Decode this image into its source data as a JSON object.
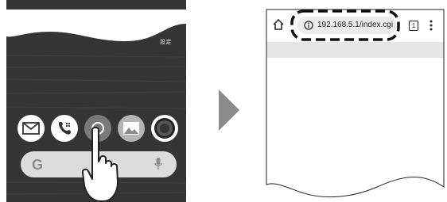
{
  "phone": {
    "settings_label": "設定",
    "dock_apps": [
      {
        "name": "mail",
        "icon": "envelope-icon"
      },
      {
        "name": "phone",
        "icon": "phone-icon"
      },
      {
        "name": "browser",
        "icon": "browser-circle-icon"
      },
      {
        "name": "gallery",
        "icon": "image-icon"
      },
      {
        "name": "camera",
        "icon": "camera-icon"
      }
    ],
    "search_bar": {
      "logo": "G",
      "mic_icon": "microphone-icon"
    },
    "gesture": "tap-hand-icon"
  },
  "arrow": {
    "icon": "right-arrow-icon"
  },
  "browser": {
    "home_icon": "home-icon",
    "info_icon": "info-icon",
    "url": "192.168.5.1/index.cgi",
    "tab_count": "1",
    "menu_icon": "more-vert-icon"
  },
  "colors": {
    "phone_bg": "#333333",
    "arrow": "#8c8c8c",
    "url_pill": "#ececec"
  }
}
